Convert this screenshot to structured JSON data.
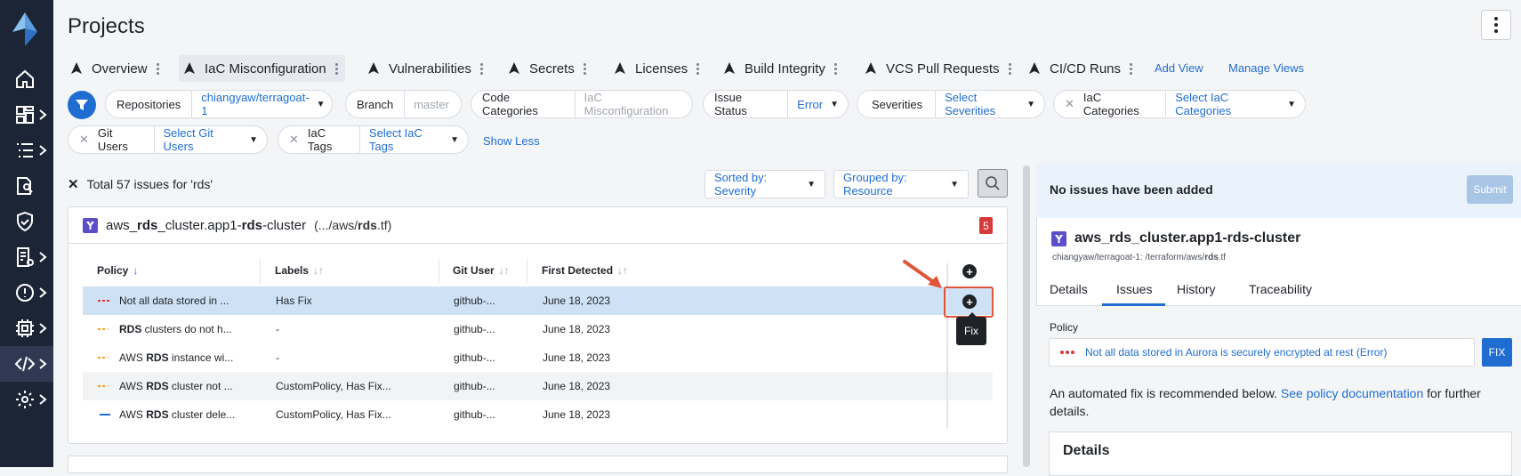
{
  "page": {
    "title": "Projects"
  },
  "tabs": [
    {
      "label": "Overview",
      "active": false
    },
    {
      "label": "IaC Misconfiguration",
      "active": true
    },
    {
      "label": "Vulnerabilities",
      "active": false
    },
    {
      "label": "Secrets",
      "active": false
    },
    {
      "label": "Licenses",
      "active": false
    },
    {
      "label": "Build Integrity",
      "active": false
    },
    {
      "label": "VCS Pull Requests",
      "active": false
    },
    {
      "label": "CI/CD Runs",
      "active": false
    }
  ],
  "tab_links": {
    "add_view": "Add View",
    "manage_views": "Manage Views"
  },
  "filters": {
    "repositories": {
      "label": "Repositories",
      "value": "chiangyaw/terragoat-1"
    },
    "branch": {
      "label": "Branch",
      "value": "master"
    },
    "code_categories": {
      "label": "Code Categories",
      "value": "IaC Misconfiguration"
    },
    "issue_status": {
      "label": "Issue Status",
      "value": "Error"
    },
    "severities": {
      "label": "Severities",
      "value": "Select Severities"
    },
    "iac_categories": {
      "label": "IaC Categories",
      "value": "Select IaC Categories"
    },
    "git_users": {
      "label": "Git Users",
      "value": "Select Git Users"
    },
    "iac_tags": {
      "label": "IaC Tags",
      "value": "Select IaC Tags"
    },
    "show_less": "Show Less"
  },
  "results": {
    "total_prefix": "Total 57 issues for 'rds'",
    "sort": "Sorted by: Severity",
    "group": "Grouped by: Resource"
  },
  "resource_card": {
    "name_parts": [
      "aws_",
      "rds",
      "_cluster.app1-",
      "rds",
      "-cluster"
    ],
    "path_parts": [
      "(.../aws/",
      "rds",
      ".tf)"
    ],
    "count": "5",
    "columns": {
      "policy": "Policy",
      "labels": "Labels",
      "git_user": "Git User",
      "first_detected": "First Detected"
    },
    "rows": [
      {
        "policy_pre": "Not all data stored in ...",
        "policy_bold": "",
        "policy_post": "",
        "labels": "Has Fix",
        "git_user": "github-...",
        "first_detected": "June 18, 2023",
        "severity": "high"
      },
      {
        "policy_pre": "",
        "policy_bold": "RDS",
        "policy_post": " clusters do not h...",
        "labels": "-",
        "git_user": "github-...",
        "first_detected": "June 18, 2023",
        "severity": "medium"
      },
      {
        "policy_pre": "AWS ",
        "policy_bold": "RDS",
        "policy_post": " instance wi...",
        "labels": "-",
        "git_user": "github-...",
        "first_detected": "June 18, 2023",
        "severity": "medium"
      },
      {
        "policy_pre": "AWS ",
        "policy_bold": "RDS",
        "policy_post": " cluster not ...",
        "labels": "CustomPolicy, Has Fix...",
        "git_user": "github-...",
        "first_detected": "June 18, 2023",
        "severity": "medium"
      },
      {
        "policy_pre": "AWS ",
        "policy_bold": "RDS",
        "policy_post": " cluster dele...",
        "labels": "CustomPolicy, Has Fix...",
        "git_user": "github-...",
        "first_detected": "June 18, 2023",
        "severity": "info"
      }
    ],
    "tooltip": "Fix"
  },
  "panel": {
    "no_issues": "No issues have been added",
    "submit": "Submit",
    "resource_title": "aws_rds_cluster.app1-rds-cluster",
    "resource_sub_pre": "chiangyaw/terragoat-1: /terraform/aws/",
    "resource_sub_bold": "rds",
    "resource_sub_post": ".tf",
    "tabs": [
      "Details",
      "Issues",
      "History",
      "Traceability"
    ],
    "policy_label": "Policy",
    "policy_text": "Not all data stored in Aurora is securely encrypted at rest (Error)",
    "fix": "FIX",
    "text_pre": "An automated fix is recommended below. ",
    "text_link": "See policy documentation",
    "text_post": " for further details.",
    "details_heading": "Details"
  },
  "colors": {
    "accent": "#1f6dd0",
    "sidebar": "#1c2536",
    "error": "#d63a3a",
    "highlight": "#e0553a"
  }
}
